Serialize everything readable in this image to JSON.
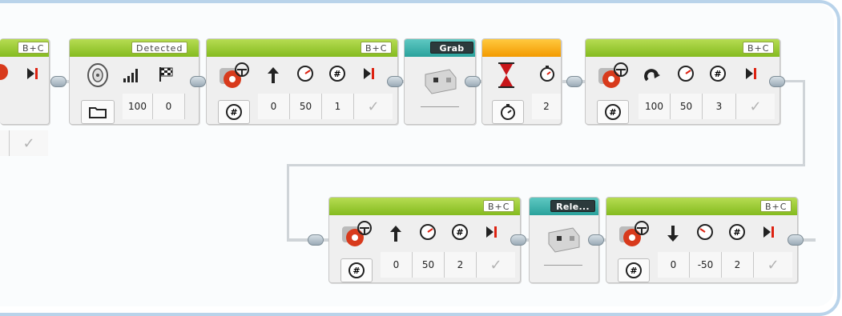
{
  "program": {
    "blocks": {
      "move_partial": {
        "port": "B+C",
        "values": [
          ""
        ]
      },
      "sound_sensor": {
        "label": "Detected",
        "values": [
          "100",
          "0"
        ]
      },
      "move_1": {
        "port": "B+C",
        "values": [
          "0",
          "50",
          "1",
          ""
        ]
      },
      "grab": {
        "label": "Grab"
      },
      "wait_timer": {
        "values": [
          "2"
        ]
      },
      "move_2": {
        "port": "B+C",
        "values": [
          "100",
          "50",
          "3",
          ""
        ]
      },
      "move_3": {
        "port": "B+C",
        "values": [
          "0",
          "50",
          "2",
          ""
        ]
      },
      "release": {
        "label": "Rele..."
      },
      "move_4": {
        "port": "B+C",
        "values": [
          "0",
          "-50",
          "2",
          ""
        ]
      }
    },
    "colors": {
      "frame_border": "#b9d3ea",
      "header_green": "#84bb1f",
      "header_teal": "#2aa29c",
      "header_orange": "#f39a00",
      "motor_red": "#d83a1c",
      "hourglass_red": "#c8161a"
    },
    "icons": [
      "motor-icon",
      "steering-icon",
      "arrow-up-icon",
      "speed-gauge-icon",
      "rotations-icon",
      "brake-icon",
      "speaker-icon",
      "bars-icon",
      "flag-icon",
      "folder-icon",
      "hourglass-icon",
      "stopwatch-icon",
      "curved-arrow-icon",
      "arrow-down-icon",
      "medium-motor-icon"
    ]
  }
}
